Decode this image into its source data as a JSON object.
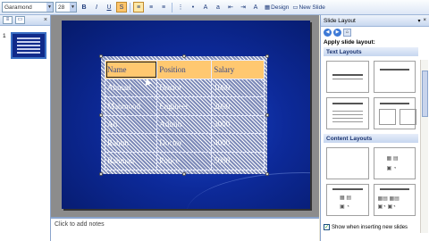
{
  "toolbar": {
    "font_name": "Garamond",
    "font_size": "28",
    "bold": "B",
    "italic": "I",
    "underline": "U",
    "shadow": "S",
    "design_label": "Design",
    "new_slide_label": "New Slide"
  },
  "thumbnails": {
    "slide_number": "1"
  },
  "table": {
    "headers": [
      "Name",
      "Position",
      "Salary"
    ],
    "rows": [
      [
        "Ahmad",
        "Doctor",
        "1000"
      ],
      [
        "Mahmood",
        "Engineer",
        "2000"
      ],
      [
        "Ali",
        "Admin",
        "3000"
      ],
      [
        "Rahim",
        "Doctor",
        "4000"
      ],
      [
        "Rahman",
        "Police",
        "5000"
      ]
    ]
  },
  "notes": {
    "placeholder": "Click to add notes"
  },
  "task_pane": {
    "title": "Slide Layout",
    "apply_label": "Apply slide layout:",
    "text_layouts_label": "Text Layouts",
    "content_layouts_label": "Content Layouts",
    "checkbox_label": "Show when inserting new slides",
    "checkbox_checked": true
  },
  "colors": {
    "slide_bg": "#0d2a9a",
    "header_row": "#ffc870",
    "accent": "#3a6fc4"
  }
}
